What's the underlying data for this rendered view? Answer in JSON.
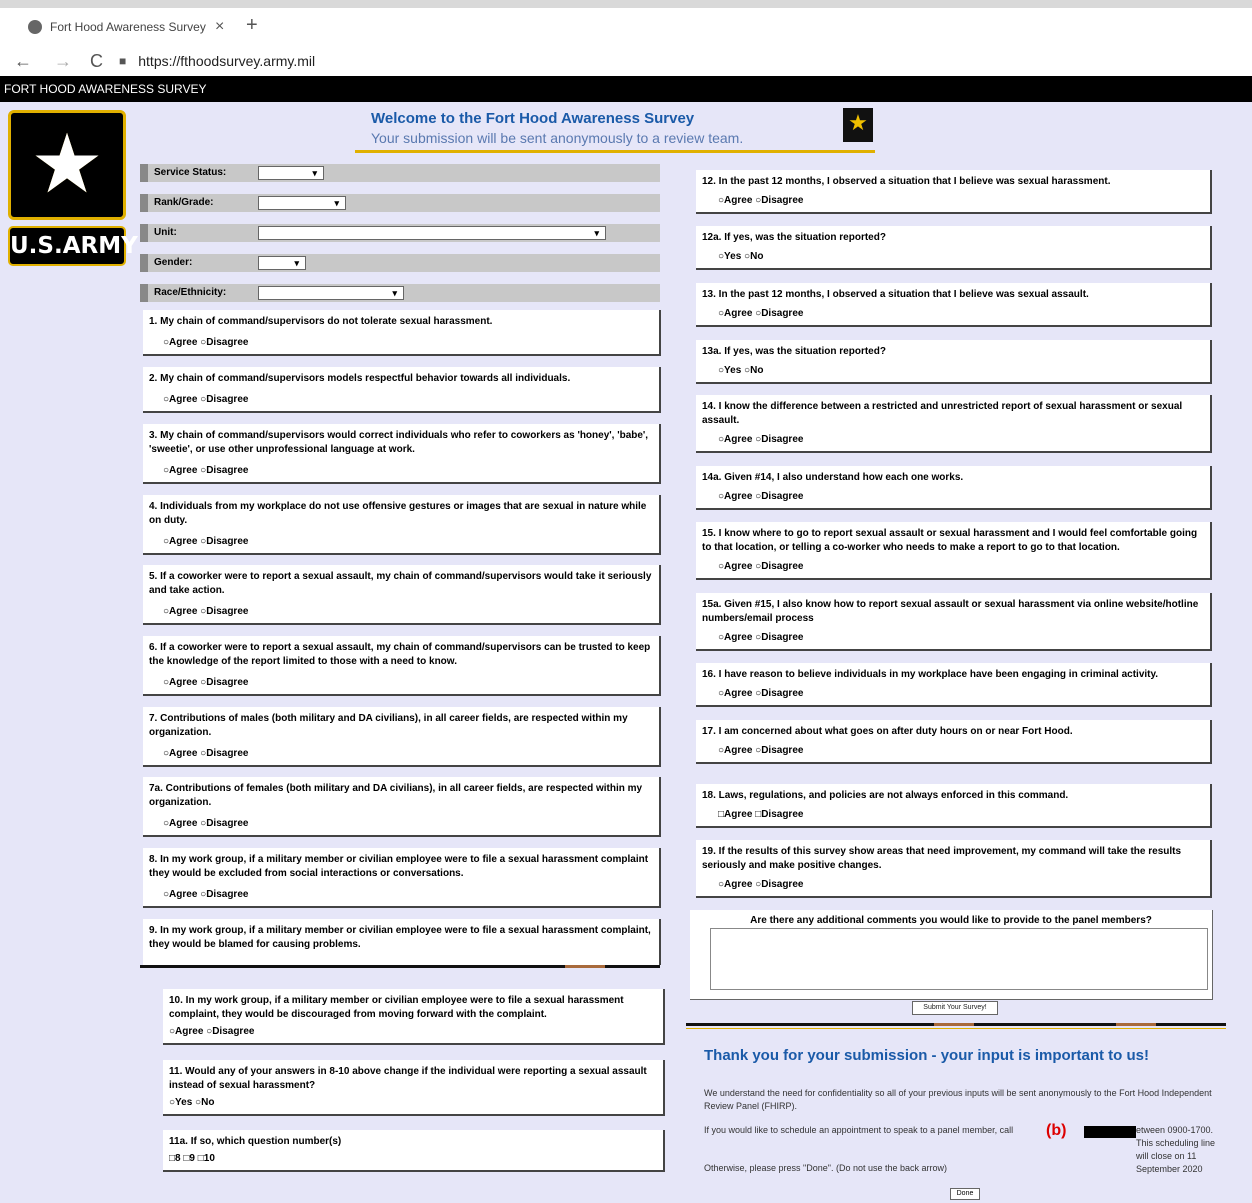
{
  "browser": {
    "tab_title": "Fort Hood Awareness Survey",
    "close": "×",
    "newtab": "+",
    "back": "←",
    "forward": "→",
    "reload": "C",
    "url": "https://fthoodsurvey.army.mil"
  },
  "site_title": "FORT HOOD AWARENESS SURVEY",
  "logo": {
    "star": "★",
    "army_text": "U.S.ARMY"
  },
  "header": {
    "title": "Welcome to the Fort Hood Awareness Survey",
    "subtitle": "Your submission will be sent anonymously to a review team."
  },
  "fields": {
    "service": {
      "label": "Service Status:"
    },
    "rank": {
      "label": "Rank/Grade:"
    },
    "unit": {
      "label": "Unit:"
    },
    "gender": {
      "label": "Gender:"
    },
    "race": {
      "label": "Race/Ethnicity:"
    }
  },
  "dropdown_arrow": "▾",
  "answers": {
    "agree_disagree": "○Agree ○Disagree",
    "agree_disagree_box": "□Agree □Disagree",
    "yes_no": "○Yes ○No"
  },
  "questions": {
    "q1": "1. My chain of command/supervisors do not tolerate sexual harassment.",
    "q2": "2. My chain of command/supervisors models respectful behavior towards all individuals.",
    "q3": "3. My chain of command/supervisors would correct individuals who refer to coworkers as 'honey', 'babe', 'sweetie', or use other unprofessional language at work.",
    "q4": "4. Individuals from my workplace do not use offensive gestures or images that are sexual in nature while on duty.",
    "q5": "5. If a coworker were to report a sexual assault, my chain of command/supervisors would take it seriously and take action.",
    "q6": "6. If a coworker were to report a sexual assault, my chain of command/supervisors can be trusted to keep the knowledge of the report limited to those with a need to know.",
    "q7": "7. Contributions of males (both military and DA civilians), in all career fields, are respected within my organization.",
    "q7a": "7a. Contributions of females (both military and DA civilians), in all career fields, are respected within my organization.",
    "q8": "8. In my work group, if a military member or civilian employee were to file a sexual harassment complaint they would be excluded from social interactions or conversations.",
    "q9": "9. In my work group, if a military member or civilian employee were to file a sexual harassment complaint, they would be blamed for causing problems.",
    "q10": "10. In my work group, if a military member or civilian employee were to file a sexual harassment complaint, they would be discouraged from moving forward with the complaint.",
    "q11": "11. Would any of your answers in 8-10 above change if the individual were reporting a sexual assault instead of sexual harassment?",
    "q11a": "11a. If so, which question number(s)",
    "q11a_opts": "□8 □9 □10",
    "q12": "12. In the past 12 months, I observed a situation that I believe was sexual harassment.",
    "q12a": "12a. If yes, was the situation reported?",
    "q13": "13. In the past 12 months, I observed a situation that I believe was sexual assault.",
    "q13a": "13a. If yes, was the situation reported?",
    "q14": "14. I know the difference between a restricted and unrestricted report of sexual harassment or sexual assault.",
    "q14a": "14a. Given #14, I also understand how each one works.",
    "q15": "15. I know where to go to report sexual assault or sexual harassment and I would feel comfortable going to that location, or telling a co-worker who needs to make a report to go to that location.",
    "q15a": "15a. Given #15, I also know how to report sexual assault or sexual harassment via online website/hotline numbers/email process",
    "q16": "16. I have reason to believe individuals in my workplace have been engaging in criminal activity.",
    "q17": "17. I am concerned about what goes on after duty hours on or near Fort Hood.",
    "q18": "18. Laws, regulations, and policies are not always enforced in this command.",
    "q19": "19. If the results of this survey show areas that need improvement, my command will take the results seriously and make positive changes."
  },
  "comments_label": "Are there any additional comments you would like to provide to the panel members?",
  "submit_label": "Submit Your Survey!",
  "thanks_title": "Thank you for your submission - your input is important to us!",
  "thanks_p1": "We understand the need for confidentiality so all of your previous inputs will be sent anonymously to the Fort Hood Independent Review Panel (FHIRP).",
  "thanks_p2a": "If you would like to schedule an appointment to speak to a panel member, call",
  "thanks_p2b": "etween 0900-1700. This scheduling line will close on 11 September 2020",
  "redact_label": "(b)",
  "thanks_p3": "Otherwise, please press \"Done\". (Do not use the back arrow)",
  "done_label": "Done",
  "colors": {
    "accent_blue": "#1a5aa8",
    "gold": "#e0b000",
    "page_bg": "#e6e6f8"
  }
}
